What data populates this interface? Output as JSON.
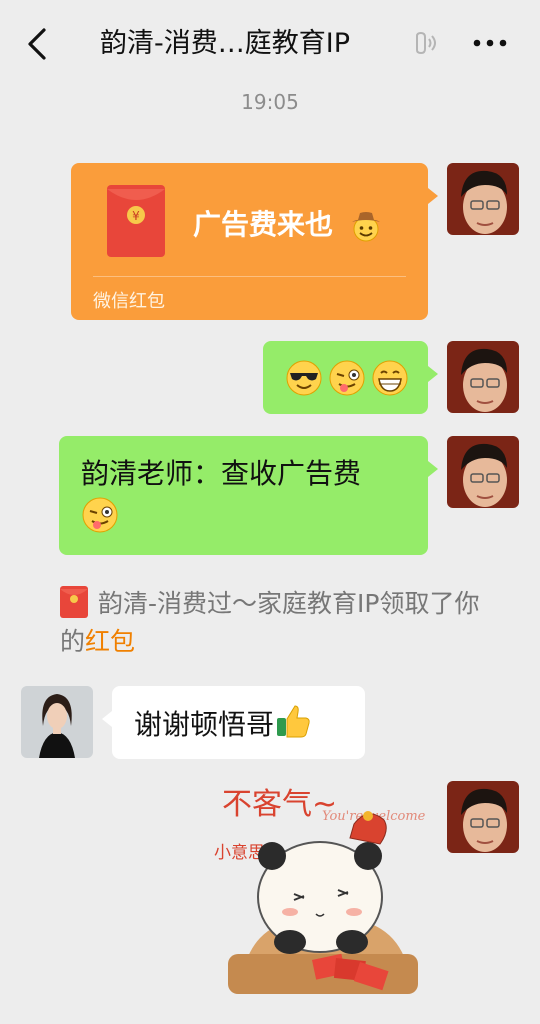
{
  "header": {
    "title": "韵清-消费…庭教育IP",
    "back_icon": "back-arrow-icon",
    "earpiece_icon": "earpiece-icon",
    "more_icon": "more-dots-icon"
  },
  "chat": {
    "timestamp": "19:05",
    "red_packet": {
      "message": "广告费来也",
      "footer": "微信红包",
      "color": "#fa9d3b"
    },
    "emoji_message": {
      "icons": [
        "sunglasses-emoji-icon",
        "wink-tongue-emoji-icon",
        "grin-emoji-icon"
      ]
    },
    "text_message": {
      "text": "韵清老师：查收广告费",
      "trailing_icon": "wink-tongue-emoji-icon"
    },
    "system_notice": {
      "prefix": "韵清-消费过～家庭教育IP领取了你的",
      "link": "红包",
      "link_color": "#f08000"
    },
    "reply_message": {
      "text": "谢谢顿悟哥",
      "trailing_icon": "thumbs-up-emoji-icon"
    },
    "sticker": {
      "caption": "不客气~",
      "subcaption": "You're welcome",
      "side_text": "小意思"
    }
  }
}
